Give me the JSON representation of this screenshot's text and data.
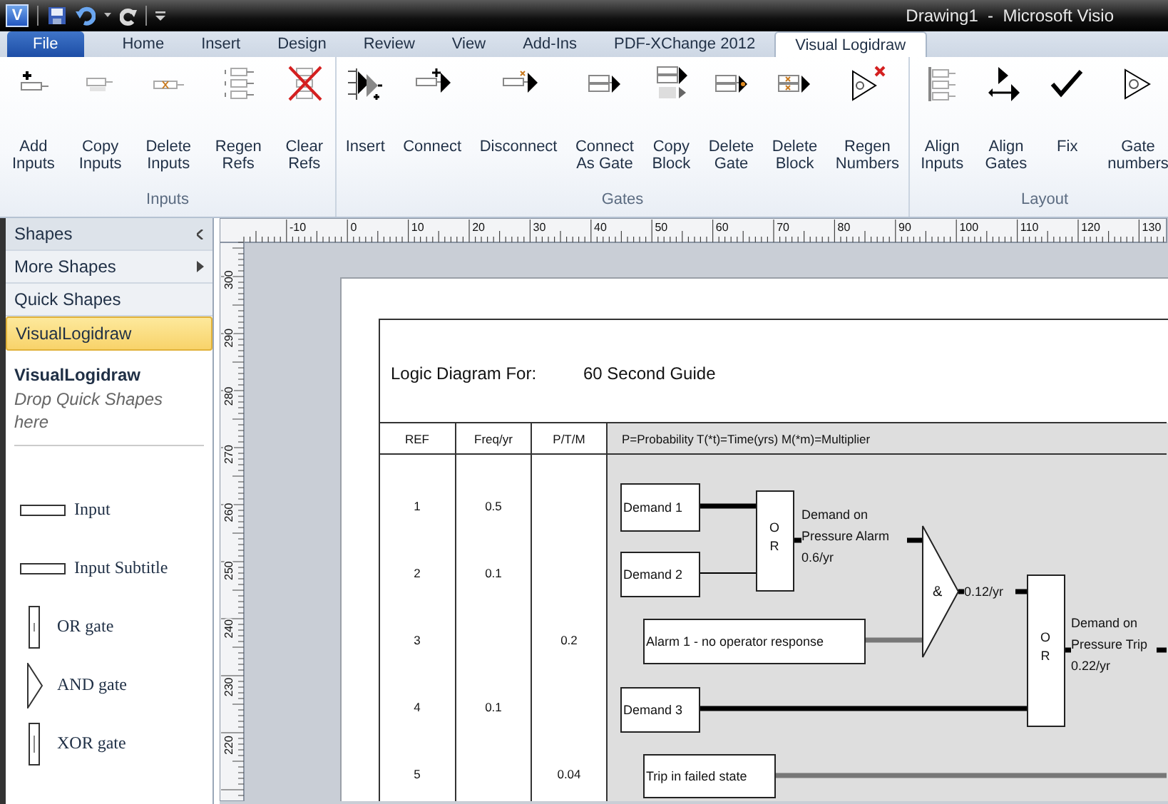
{
  "title_bar": {
    "logo": "V",
    "title": "Drawing1  -  Microsoft Visio"
  },
  "tabs": [
    {
      "label": "File",
      "kind": "file",
      "selected": false
    },
    {
      "label": "Home",
      "kind": "tab",
      "selected": false
    },
    {
      "label": "Insert",
      "kind": "tab",
      "selected": false
    },
    {
      "label": "Design",
      "kind": "tab",
      "selected": false
    },
    {
      "label": "Review",
      "kind": "tab",
      "selected": false
    },
    {
      "label": "View",
      "kind": "tab",
      "selected": false
    },
    {
      "label": "Add-Ins",
      "kind": "tab",
      "selected": false
    },
    {
      "label": "PDF-XChange 2012",
      "kind": "tab",
      "selected": false
    },
    {
      "label": "Visual Logidraw",
      "kind": "tab",
      "selected": true
    }
  ],
  "ribbon_groups": [
    {
      "label": "Inputs",
      "buttons": [
        "Add\nInputs",
        "Copy\nInputs",
        "Delete\nInputs",
        "Regen\nRefs",
        "Clear\nRefs"
      ]
    },
    {
      "label": "Gates",
      "buttons": [
        "Insert",
        "Connect",
        "Disconnect",
        "Connect\nAs Gate",
        "Copy\nBlock",
        "Delete\nGate",
        "Delete\nBlock",
        "Regen\nNumbers"
      ]
    },
    {
      "label": "Layout",
      "buttons": [
        "Align\nInputs",
        "Align\nGates",
        "Fix",
        "Gate\nnumbers"
      ]
    }
  ],
  "shapes_panel": {
    "items": [
      {
        "label": "Shapes",
        "kind": "header",
        "selected": false
      },
      {
        "label": "More Shapes",
        "kind": "submenu",
        "selected": false
      },
      {
        "label": "Quick Shapes",
        "kind": "plain",
        "selected": false
      },
      {
        "label": "VisualLogidraw",
        "kind": "plain",
        "selected": true
      }
    ],
    "stencil_title": "VisualLogidraw",
    "stencil_hint": "Drop Quick Shapes here",
    "shapes": [
      {
        "label": "Input",
        "kind": "input"
      },
      {
        "label": "Input Subtitle",
        "kind": "input"
      },
      {
        "label": "OR gate",
        "kind": "or_gate"
      },
      {
        "label": "AND gate",
        "kind": "and_gate"
      },
      {
        "label": "XOR gate",
        "kind": "xor_gate"
      }
    ]
  },
  "rulers": {
    "horizontal": [
      "-10",
      "0",
      "10",
      "20",
      "30",
      "40",
      "50",
      "60",
      "70",
      "80",
      "90",
      "100",
      "110",
      "120",
      "130"
    ],
    "vertical": [
      "300",
      "290",
      "280",
      "270",
      "260",
      "250",
      "240",
      "230",
      "220"
    ]
  },
  "diagram": {
    "heading": "Logic Diagram For:",
    "subject": "60 Second Guide",
    "columns": [
      "REF",
      "Freq/yr",
      "P/T/M",
      "P=Probability T(*t)=Time(yrs) M(*m)=Multiplier"
    ],
    "rows": [
      {
        "ref": "1",
        "freq": "0.5"
      },
      {
        "ref": "2",
        "freq": "0.1"
      },
      {
        "ref": "3",
        "ptm": "0.2"
      },
      {
        "ref": "4",
        "freq": "0.1"
      },
      {
        "ref": "5",
        "ptm": "0.04"
      }
    ],
    "blocks": [
      {
        "kind": "input",
        "label": "Demand 1"
      },
      {
        "kind": "input",
        "label": "Demand 2"
      },
      {
        "kind": "or_gate",
        "label": "OR",
        "output": [
          "Demand on",
          "Pressure Alarm",
          "0.6/yr"
        ]
      },
      {
        "kind": "input",
        "label": "Alarm 1 - no operator response"
      },
      {
        "kind": "and_gate",
        "label": "&",
        "output": [
          "0.12/yr"
        ]
      },
      {
        "kind": "or_gate",
        "label": "OR",
        "output": [
          "Demand on",
          "Pressure Trip",
          "0.22/yr"
        ]
      },
      {
        "kind": "input",
        "label": "Demand 3"
      },
      {
        "kind": "input",
        "label": "Trip in failed state"
      }
    ],
    "connectors": [
      {
        "kind": "thick"
      },
      {
        "kind": "thin"
      },
      {
        "kind": "thick"
      },
      {
        "kind": "thick"
      },
      {
        "kind": "grey"
      },
      {
        "kind": "thick"
      },
      {
        "kind": "thick"
      },
      {
        "kind": "thick"
      },
      {
        "kind": "thick"
      },
      {
        "kind": "thick"
      },
      {
        "kind": "grey"
      }
    ]
  }
}
